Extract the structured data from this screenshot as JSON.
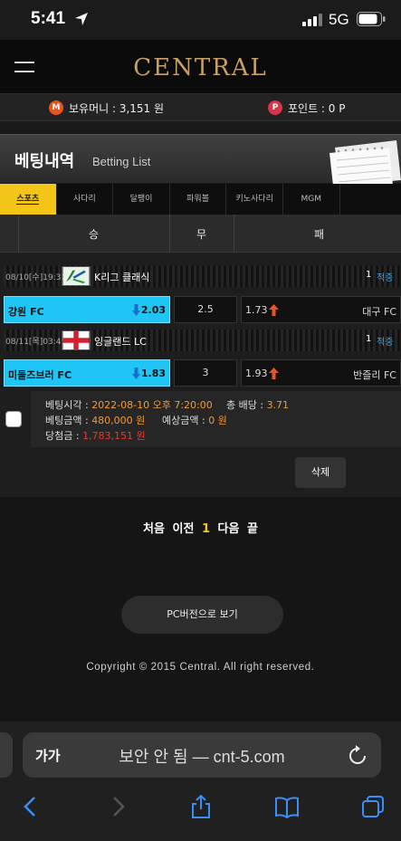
{
  "status_bar": {
    "time": "5:41",
    "network": "5G"
  },
  "header": {
    "logo": "CENTRAL"
  },
  "account": {
    "money_icon": "M",
    "money_text": "보유머니 : 3,151 원",
    "point_icon": "P",
    "point_text": "포인트 : 0 P"
  },
  "page": {
    "title": "베팅내역",
    "subtitle": "Betting List"
  },
  "tabs": [
    {
      "label": "스포츠",
      "active": true
    },
    {
      "label": "사다리",
      "active": false
    },
    {
      "label": "달팽이",
      "active": false
    },
    {
      "label": "파워볼",
      "active": false
    },
    {
      "label": "키노사다리",
      "active": false
    },
    {
      "label": "MGM",
      "active": false
    }
  ],
  "columns": {
    "win": "승",
    "draw": "무",
    "lose": "패"
  },
  "bets": [
    {
      "date": "08/10[수]19:30",
      "league": "K리그 클래식",
      "count": "1",
      "status": "적중",
      "home": "강원 FC",
      "home_odds": "2.03",
      "draw_odds": "2.5",
      "away_odds": "1.73",
      "away": "대구 FC"
    },
    {
      "date": "08/11[목]03:45",
      "league": "잉글랜드 LC",
      "count": "1",
      "status": "적중",
      "home": "미들즈브러 FC",
      "home_odds": "1.83",
      "draw_odds": "3",
      "away_odds": "1.93",
      "away": "반즐리 FC"
    }
  ],
  "summary": {
    "time_label": "베팅시각 : ",
    "time_value": "2022-08-10 오후 7:20:00",
    "total_odds_label": "총 배당 : ",
    "total_odds_value": "3.71",
    "amount_label": "베팅금액 : ",
    "amount_value": "480,000 원",
    "expected_label": "예상금액 : ",
    "expected_value": "0 원",
    "won_label": "당첨금 : ",
    "won_value": "1,783,151 원"
  },
  "delete_label": "삭제",
  "pager": {
    "first": "처음",
    "prev": "이전",
    "current": "1",
    "next": "다음",
    "last": "끝"
  },
  "pc_view_label": "PC버전으로 보기",
  "copyright": "Copyright © 2015 Central. All right reserved.",
  "safari": {
    "aa": "가가",
    "url": "보안 안 됨 — cnt-5.com"
  },
  "colors": {
    "accent": "#f3c519",
    "home_selected": "#1fc6f5",
    "status_blue": "#3aa3e8",
    "win_red": "#e63a2e",
    "orange": "#f39a34"
  }
}
